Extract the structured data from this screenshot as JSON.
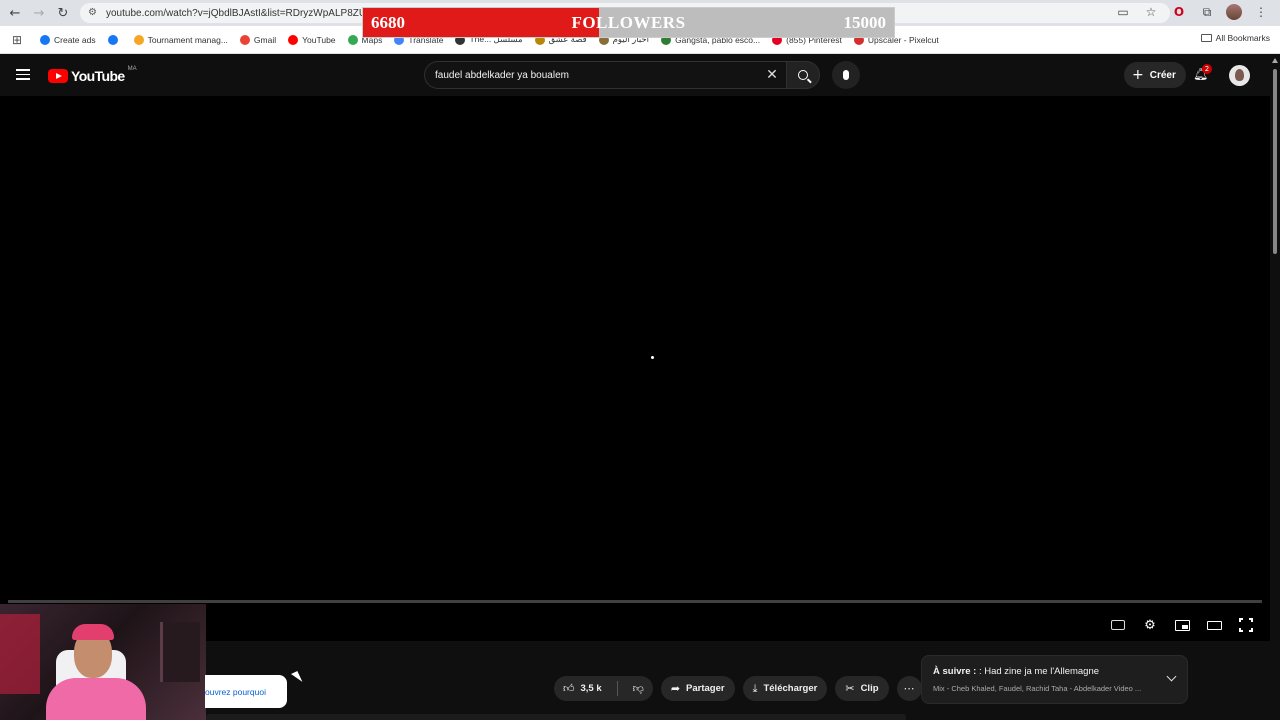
{
  "browser": {
    "url": "youtube.com/watch?v=jQbdlBJAstI&list=RDryzWpALP8ZU&in",
    "bookmarks": [
      {
        "label": "Create ads",
        "color": "#1877f2"
      },
      {
        "label": "",
        "color": "#1877f2"
      },
      {
        "label": "Tournament manag...",
        "color": "#f5a623"
      },
      {
        "label": "Gmail",
        "color": "#ea4335"
      },
      {
        "label": "YouTube",
        "color": "#ff0000"
      },
      {
        "label": "Maps",
        "color": "#34a853"
      },
      {
        "label": "Translate",
        "color": "#4285f4"
      },
      {
        "label": "The... مسلسل",
        "color": "#333333"
      },
      {
        "label": "قصة عشق",
        "color": "#b8860b"
      },
      {
        "label": "أخبار اليوم",
        "color": "#8a6d3b"
      },
      {
        "label": "Gangsta, pablo esco...",
        "color": "#2e7d32"
      },
      {
        "label": "(855) Pinterest",
        "color": "#e60023"
      },
      {
        "label": "Upscaler - Pixelcut",
        "color": "#d32f2f"
      }
    ],
    "all_bookmarks": "All Bookmarks"
  },
  "followers_overlay": {
    "current": "6680",
    "label": "FOLLOWERS",
    "goal": "15000",
    "progress": 0.445
  },
  "header": {
    "logo_text": "YouTube",
    "country_code": "MA",
    "search_value": "faudel abdelkader ya boualem",
    "create_label": "Créer",
    "notification_count": "2"
  },
  "below_player": {
    "why_chip": "ouvrez pourquoi",
    "like_count": "3,5 k",
    "share_label": "Partager",
    "download_label": "Télécharger",
    "clip_label": "Clip"
  },
  "up_next": {
    "prefix": "À suivre :",
    "title": ": Had zine ja me l'Allemagne",
    "subtitle": "Mix - Cheb Khaled, Faudel, Rachid Taha - Abdelkader Video ..."
  }
}
